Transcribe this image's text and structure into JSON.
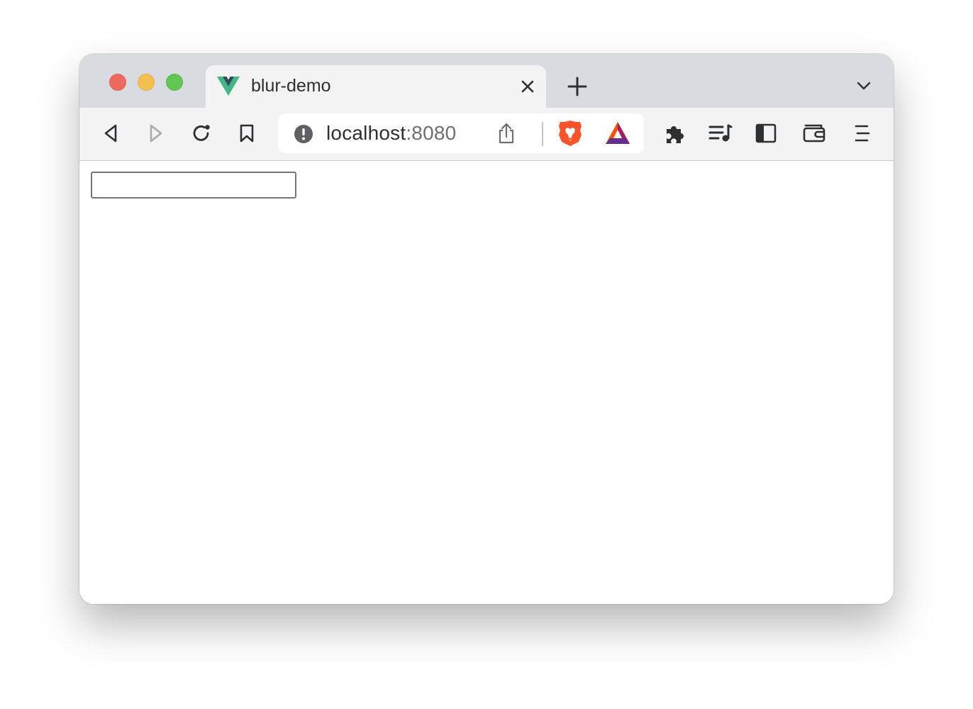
{
  "tab": {
    "title": "blur-demo",
    "favicon": "vue-logo-icon"
  },
  "address_bar": {
    "host": "localhost",
    "port": ":8080"
  },
  "content": {
    "input_value": ""
  },
  "colors": {
    "traffic_red": "#ed6a5e",
    "traffic_yellow": "#f5bf4f",
    "traffic_green": "#62c554",
    "vue_green": "#41b883",
    "vue_dark": "#35495e",
    "brave_orange": "#fb542b"
  }
}
